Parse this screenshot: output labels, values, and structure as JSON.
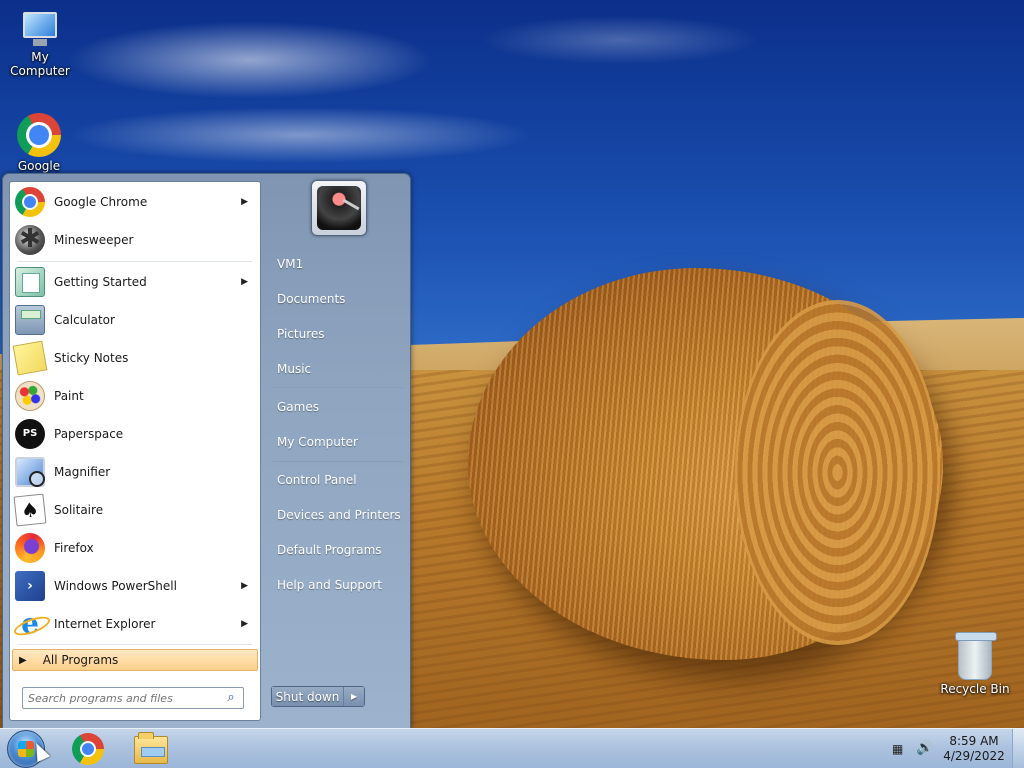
{
  "desktop": {
    "icons": [
      {
        "label": "My Computer",
        "icon": "computer-icon"
      },
      {
        "label": "Google",
        "icon": "chrome-icon"
      },
      {
        "label": "Recycle Bin",
        "icon": "recycle-bin-icon"
      }
    ]
  },
  "start_menu": {
    "programs": [
      {
        "label": "Google Chrome",
        "icon": "chrome-icon",
        "has_submenu": true
      },
      {
        "label": "Minesweeper",
        "icon": "minesweeper-icon",
        "has_submenu": false
      },
      {
        "label": "Getting Started",
        "icon": "getting-started-icon",
        "has_submenu": true
      },
      {
        "label": "Calculator",
        "icon": "calculator-icon",
        "has_submenu": false
      },
      {
        "label": "Sticky Notes",
        "icon": "sticky-notes-icon",
        "has_submenu": false
      },
      {
        "label": "Paint",
        "icon": "paint-icon",
        "has_submenu": false
      },
      {
        "label": "Paperspace",
        "icon": "paperspace-icon",
        "has_submenu": false
      },
      {
        "label": "Magnifier",
        "icon": "magnifier-icon",
        "has_submenu": false
      },
      {
        "label": "Solitaire",
        "icon": "solitaire-icon",
        "has_submenu": false
      },
      {
        "label": "Firefox",
        "icon": "firefox-icon",
        "has_submenu": false
      },
      {
        "label": "Windows PowerShell",
        "icon": "powershell-icon",
        "has_submenu": true
      },
      {
        "label": "Internet Explorer",
        "icon": "internet-explorer-icon",
        "has_submenu": true
      }
    ],
    "paperspace_badge": "PS",
    "all_programs": "All Programs",
    "search": {
      "placeholder": "Search programs and files",
      "value": ""
    },
    "right_items": [
      {
        "label": "VM1"
      },
      {
        "label": "Documents"
      },
      {
        "label": "Pictures"
      },
      {
        "label": "Music"
      },
      {
        "label": "Games"
      },
      {
        "label": "My Computer"
      },
      {
        "label": "Control Panel"
      },
      {
        "label": "Devices and Printers"
      },
      {
        "label": "Default Programs"
      },
      {
        "label": "Help and Support"
      }
    ],
    "shutdown_label": "Shut down"
  },
  "taskbar": {
    "pinned": [
      "chrome-icon",
      "windows-explorer-icon"
    ],
    "clock_time": "8:59 AM",
    "clock_date": "4/29/2022"
  },
  "colors": {
    "all_programs_highlight": "#ffcf8a",
    "start_menu_frame": "#8fa5c0",
    "taskbar": "#adc3df"
  }
}
